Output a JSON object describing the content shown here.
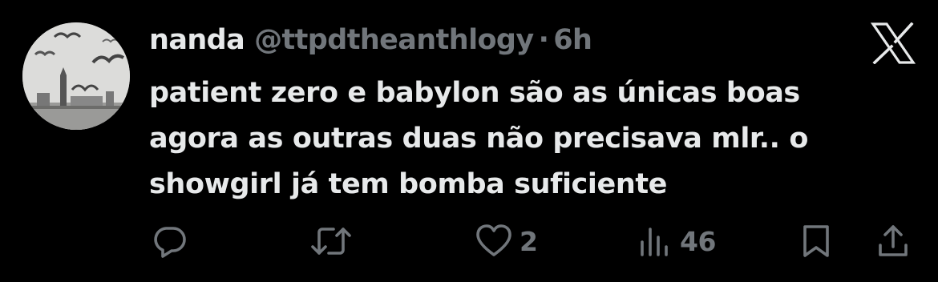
{
  "tweet": {
    "author": {
      "display_name": "nanda",
      "handle": "@ttpdtheanthlogy",
      "separator": "·",
      "time": "6h"
    },
    "text_lines": [
      "patient zero e babylon são as únicas boas",
      "agora as outras duas não precisava mlr.. o",
      "showgirl já tem bomba suficiente"
    ],
    "actions": {
      "reply_icon": "reply-icon",
      "repost_icon": "repost-icon",
      "like_icon": "heart-icon",
      "like_count": "2",
      "views_icon": "views-icon",
      "views_count": "46",
      "bookmark_icon": "bookmark-icon",
      "share_icon": "share-icon"
    },
    "logo_icon": "x-logo-icon"
  },
  "colors": {
    "background": "#000000",
    "primary_text": "#e7e9ea",
    "secondary_text": "#71767b"
  }
}
